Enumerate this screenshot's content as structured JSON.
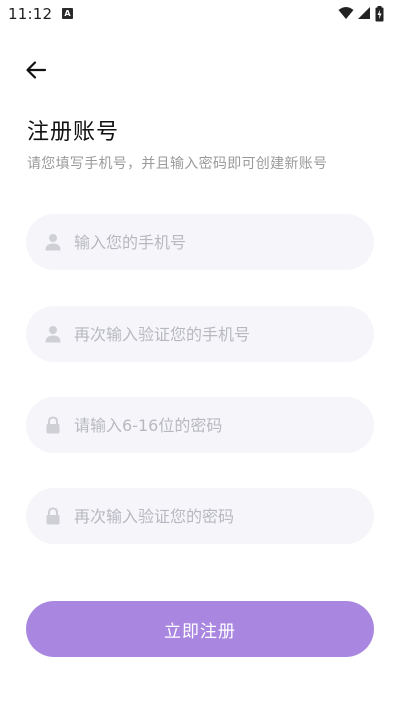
{
  "status_bar": {
    "time": "11:12",
    "notification_icon": "a-icon",
    "icons": [
      "wifi-icon",
      "signal-icon",
      "battery-charging-icon"
    ]
  },
  "header": {
    "back_icon": "arrow-left-icon"
  },
  "title": "注册账号",
  "subtitle": "请您填写手机号，并且输入密码即可创建新账号",
  "fields": {
    "phone": {
      "icon": "user-icon",
      "placeholder": "输入您的手机号",
      "value": ""
    },
    "phone_confirm": {
      "icon": "user-icon",
      "placeholder": "再次输入验证您的手机号",
      "value": ""
    },
    "password": {
      "icon": "lock-icon",
      "placeholder": "请输入6-16位的密码",
      "value": ""
    },
    "password_confirm": {
      "icon": "lock-icon",
      "placeholder": "再次输入验证您的密码",
      "value": ""
    }
  },
  "submit_label": "立即注册",
  "colors": {
    "accent": "#a987e0",
    "field_background": "#f5f5fa",
    "placeholder": "#b8b8c0",
    "subtitle": "#9a9a9a"
  }
}
